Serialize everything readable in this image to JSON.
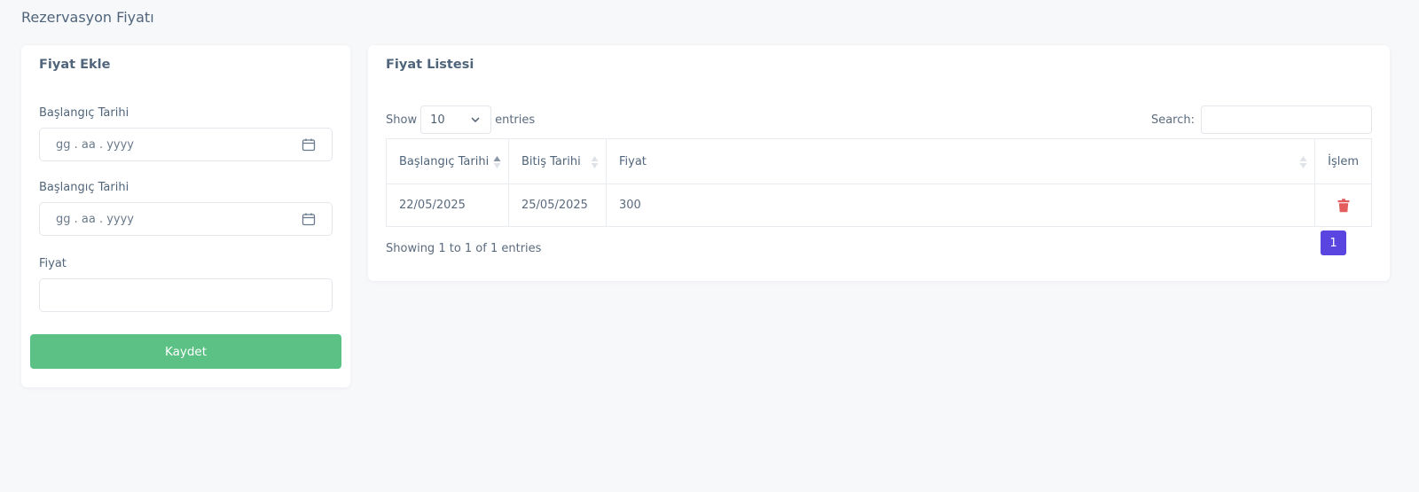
{
  "page": {
    "title": "Rezervasyon Fiyatı"
  },
  "form": {
    "title": "Fiyat Ekle",
    "fields": [
      {
        "label": "Başlangıç Tarihi",
        "placeholder": "gg . aa . yyyy",
        "icon": "calendar-icon"
      },
      {
        "label": "Başlangıç Tarihi",
        "placeholder": "gg . aa . yyyy",
        "icon": "calendar-icon"
      },
      {
        "label": "Fiyat",
        "placeholder": ""
      }
    ],
    "save_label": "Kaydet",
    "save_color": "#5cc184"
  },
  "list": {
    "title": "Fiyat Listesi",
    "show_label": "Show",
    "length_value": "10",
    "entries_label": "entries",
    "search_label": "Search:",
    "search_value": "",
    "columns": [
      "Başlangıç Tarihi",
      "Bitiş Tarihi",
      "Fiyat",
      "İşlem"
    ],
    "rows": [
      {
        "start": "22/05/2025",
        "end": "25/05/2025",
        "price": "300",
        "action_icon": "trash-icon"
      }
    ],
    "info": "Showing 1 to 1 of 1 entries",
    "pagination": {
      "current": "1"
    },
    "accent_color": "#5b45e0",
    "delete_color": "#e35d5d"
  }
}
